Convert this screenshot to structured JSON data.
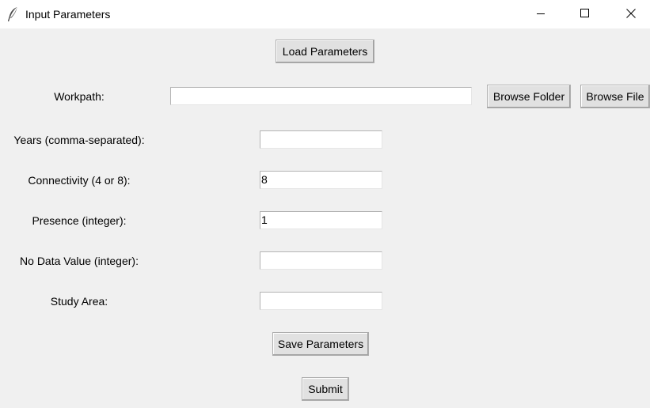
{
  "window": {
    "title": "Input Parameters",
    "minimize_icon": "minimize-icon",
    "maximize_icon": "maximize-icon",
    "close_icon": "close-icon",
    "app_icon": "feather-icon"
  },
  "toolbar": {
    "load_label": "Load Parameters",
    "save_label": "Save Parameters",
    "submit_label": "Submit"
  },
  "workpath": {
    "label": "Workpath:",
    "value": "",
    "browse_folder_label": "Browse Folder",
    "browse_file_label": "Browse File"
  },
  "fields": {
    "years": {
      "label": "Years (comma-separated):",
      "value": ""
    },
    "connectivity": {
      "label": "Connectivity (4 or 8):",
      "value": "8"
    },
    "presence": {
      "label": "Presence (integer):",
      "value": "1"
    },
    "nodata": {
      "label": "No Data Value (integer):",
      "value": ""
    },
    "study_area": {
      "label": "Study Area:",
      "value": ""
    }
  }
}
